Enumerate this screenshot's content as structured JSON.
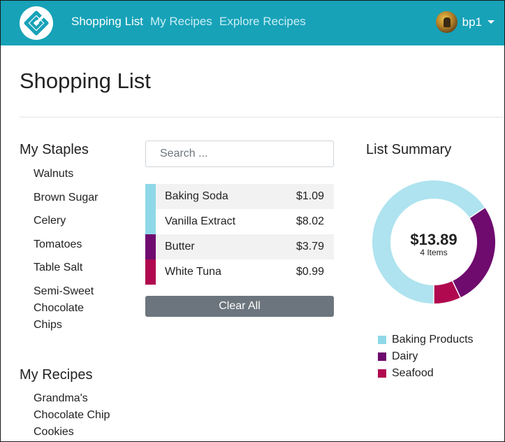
{
  "navbar": {
    "brand_icon": "diamond-logo-icon",
    "links": [
      {
        "label": "Shopping List",
        "active": true
      },
      {
        "label": "My Recipes",
        "active": false
      },
      {
        "label": "Explore Recipes",
        "active": false
      }
    ],
    "user": {
      "name": "bp1",
      "avatar_icon": "user-avatar"
    }
  },
  "page": {
    "title": "Shopping List"
  },
  "staples": {
    "title": "My Staples",
    "items": [
      "Walnuts",
      "Brown Sugar",
      "Celery",
      "Tomatoes",
      "Table Salt",
      "Semi-Sweet Chocolate Chips"
    ]
  },
  "recipes": {
    "title": "My Recipes",
    "items": [
      "Grandma's Chocolate Chip Cookies"
    ]
  },
  "search": {
    "placeholder": "Search ...",
    "value": ""
  },
  "list": {
    "items": [
      {
        "name": "Baking Soda",
        "price": "$1.09",
        "category": "Baking Products",
        "color": "#8fd8e8"
      },
      {
        "name": "Vanilla Extract",
        "price": "$8.02",
        "category": "Baking Products",
        "color": "#8fd8e8"
      },
      {
        "name": "Butter",
        "price": "$3.79",
        "category": "Dairy",
        "color": "#6f0b6e"
      },
      {
        "name": "White Tuna",
        "price": "$0.99",
        "category": "Seafood",
        "color": "#b0094f"
      }
    ],
    "clear_label": "Clear All"
  },
  "summary": {
    "title": "List Summary",
    "total": "$13.89",
    "count": "4 Items"
  },
  "chart_data": {
    "type": "pie",
    "donut": true,
    "categories": [
      "Baking Products",
      "Dairy",
      "Seafood"
    ],
    "values": [
      9.11,
      3.79,
      0.99
    ],
    "colors": [
      "#aee3ef",
      "#6f0b6e",
      "#b0094f"
    ],
    "legend_position": "bottom"
  }
}
